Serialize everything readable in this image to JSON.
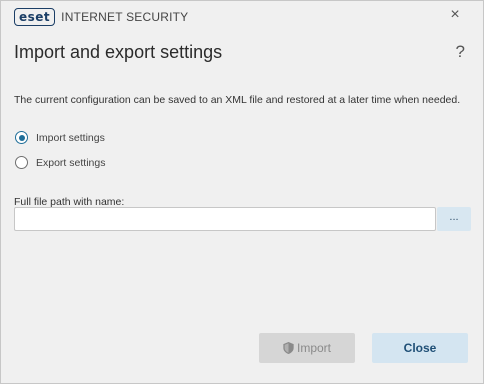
{
  "titlebar": {
    "brand": "eset",
    "product": "INTERNET SECURITY",
    "close_glyph": "×"
  },
  "header": {
    "title": "Import and export settings",
    "help_glyph": "?"
  },
  "description": "The current configuration can be saved to an XML file and restored at a later time when needed.",
  "options": {
    "import_label": "Import settings",
    "export_label": "Export settings",
    "selected": "import"
  },
  "file_field": {
    "label": "Full file path with name:",
    "value": "",
    "browse_label": "..."
  },
  "buttons": {
    "import_label": "Import",
    "close_label": "Close"
  },
  "colors": {
    "accent": "#1f6e99",
    "brand": "#1b3e66"
  },
  "icons": {
    "import": "shield-icon",
    "close": "close-icon",
    "help": "help-icon"
  }
}
